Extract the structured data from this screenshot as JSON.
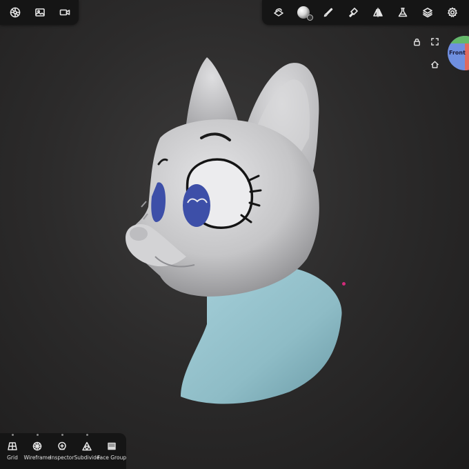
{
  "top_left_tools": [
    {
      "name": "scene-icon"
    },
    {
      "name": "image-icon"
    },
    {
      "name": "camera-icon"
    }
  ],
  "top_right_tools": [
    {
      "name": "layers-stack-icon"
    },
    {
      "name": "matcap-icon"
    },
    {
      "name": "brush-icon"
    },
    {
      "name": "paint-icon"
    },
    {
      "name": "symmetry-icon"
    },
    {
      "name": "flask-icon"
    },
    {
      "name": "layers-icon"
    },
    {
      "name": "settings-icon"
    }
  ],
  "view_gizmo": {
    "label": "Front",
    "colors": {
      "front": "#6f8fe0",
      "right": "#e06a5f",
      "top": "#64b869"
    }
  },
  "bottom_tools": [
    {
      "label": "Grid",
      "icon": "grid-icon"
    },
    {
      "label": "Wireframe",
      "icon": "wireframe-icon"
    },
    {
      "label": "Inspector",
      "icon": "inspector-icon"
    },
    {
      "label": "Subdivide",
      "icon": "subdivide-icon"
    },
    {
      "label": "Face Group",
      "icon": "face-group-icon"
    }
  ],
  "model": {
    "head_color": "#c9c9cb",
    "neck_color": "#8fbcc7",
    "eye_color": "#3d4fa8"
  }
}
